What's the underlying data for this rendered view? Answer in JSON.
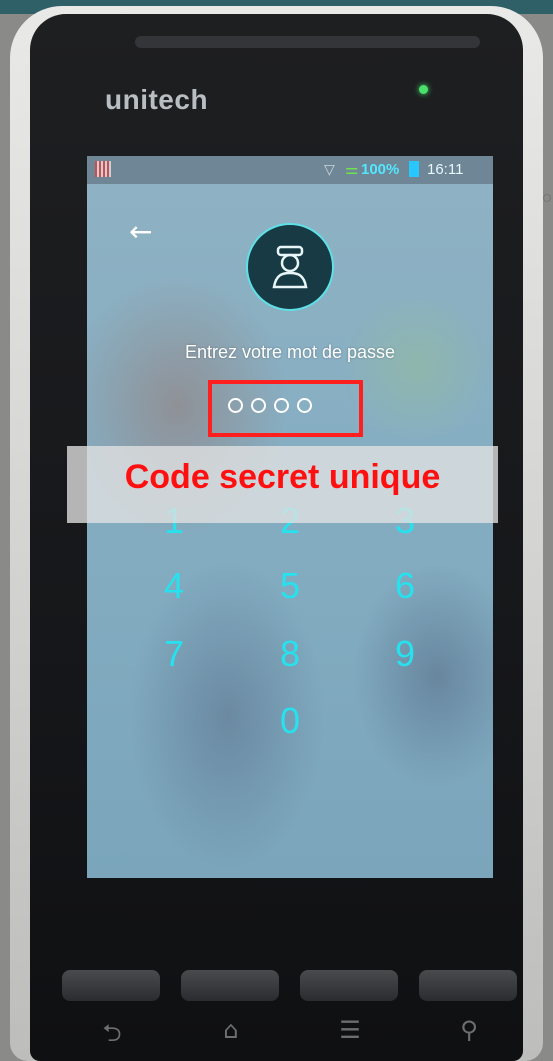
{
  "device": {
    "brand": "unitech"
  },
  "status_bar": {
    "battery": "100%",
    "time": "16:11"
  },
  "login": {
    "prompt": "Entrez votre mot de passe",
    "pin_length": 4
  },
  "keypad": {
    "keys": [
      "1",
      "2",
      "3",
      "4",
      "5",
      "6",
      "7",
      "8",
      "9",
      "0"
    ]
  },
  "annotation": {
    "label": "Code secret unique",
    "color": "#ff1010"
  },
  "colors": {
    "key_text": "#25e2ee",
    "highlight_border": "#ff1f1f"
  },
  "nav": {
    "icons": [
      "back-icon",
      "home-icon",
      "menu-icon",
      "search-icon"
    ]
  }
}
